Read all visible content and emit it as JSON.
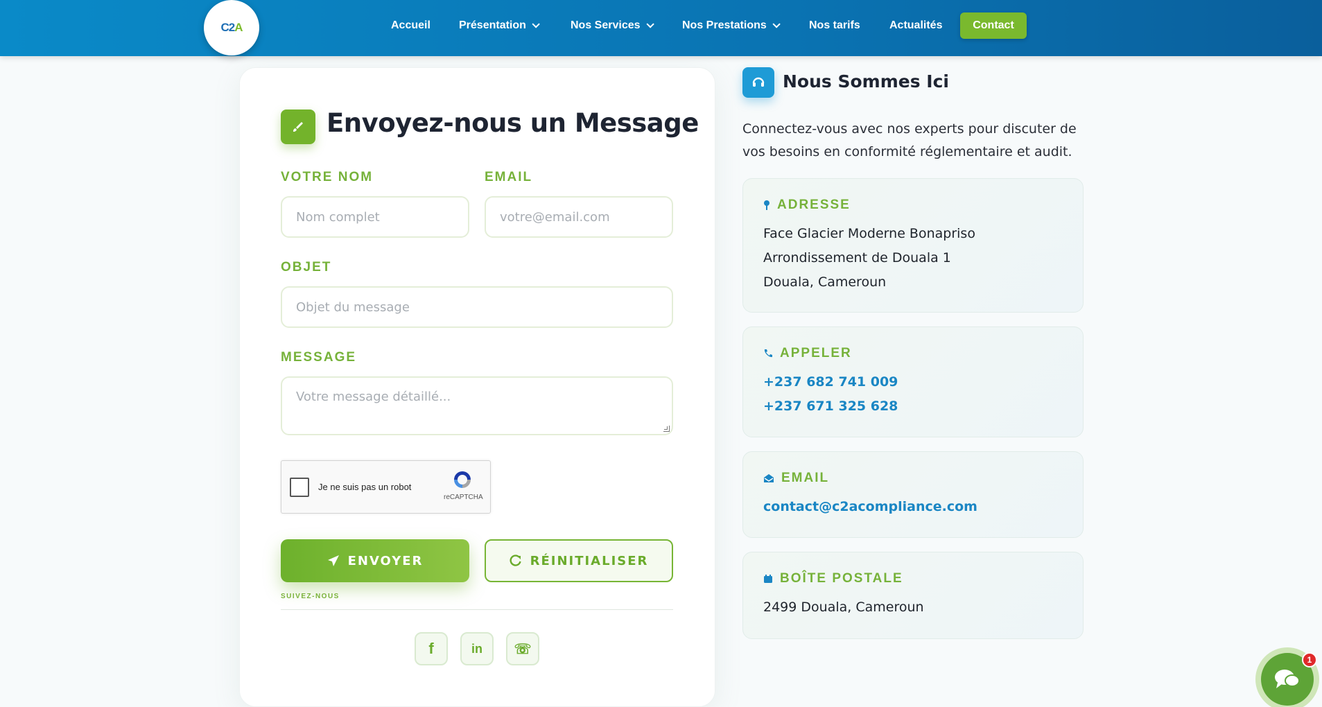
{
  "header": {
    "logo_text_a": "C2",
    "logo_text_b": "A",
    "nav": [
      {
        "label": "Accueil"
      },
      {
        "label": "Présentation"
      },
      {
        "label": "Nos Services"
      },
      {
        "label": "Nos Prestations"
      },
      {
        "label": "Nos tarifs"
      },
      {
        "label": "Actualités"
      }
    ],
    "contact_label": "Contact"
  },
  "form": {
    "title": "Envoyez-nous un Message",
    "name_label": "VOTRE NOM",
    "name_placeholder": "Nom complet",
    "email_label": "EMAIL",
    "email_placeholder": "votre@email.com",
    "subject_label": "OBJET",
    "subject_placeholder": "Objet du message",
    "message_label": "MESSAGE",
    "message_placeholder": "Votre message détaillé...",
    "recaptcha_label": "Je ne suis pas un robot",
    "recaptcha_brand": "reCAPTCHA",
    "send_label": "ENVOYER",
    "reset_label": "RÉINITIALISER",
    "follow_label": "SUIVEZ-NOUS",
    "social": [
      {
        "icon": "facebook-icon",
        "glyph": "f"
      },
      {
        "icon": "linkedin-icon",
        "glyph": "in"
      },
      {
        "icon": "whatsapp-icon",
        "glyph": "☏"
      }
    ]
  },
  "location": {
    "title": "Nous Sommes Ici",
    "description": "Connectez-vous avec nos experts pour discuter de vos besoins en conformité réglementaire et audit.",
    "address": {
      "heading": "ADRESSE",
      "lines": [
        "Face Glacier Moderne Bonapriso",
        "Arrondissement de Douala 1",
        "Douala, Cameroun"
      ]
    },
    "phone": {
      "heading": "APPELER",
      "numbers": [
        "+237 682 741 009",
        "+237 671 325 628"
      ]
    },
    "email": {
      "heading": "EMAIL",
      "address": "contact@c2acompliance.com"
    },
    "postal": {
      "heading": "BOÎTE POSTALE",
      "value": "2499 Douala, Cameroun"
    }
  },
  "chat": {
    "badge_count": "1"
  },
  "colors": {
    "primary_blue": "#0a7fbf",
    "accent_green": "#73b32b",
    "link_blue": "#1a86c4"
  }
}
